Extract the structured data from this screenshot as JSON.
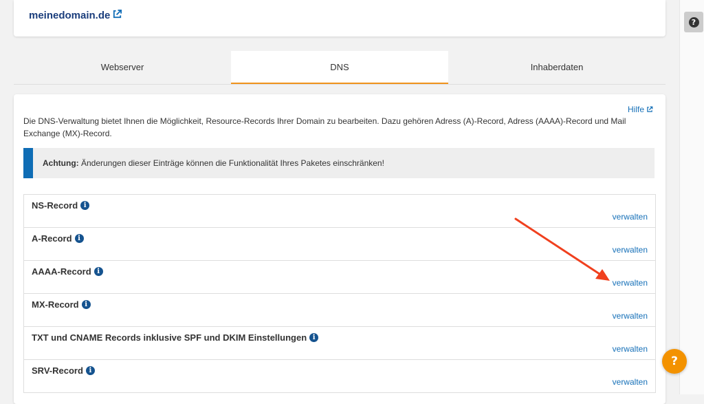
{
  "domain": {
    "name": "meinedomain.de",
    "external_icon": "external-link-icon"
  },
  "help_button": {
    "symbol": "?",
    "icon": "question-icon"
  },
  "tabs": [
    {
      "label": "Webserver",
      "active": false
    },
    {
      "label": "DNS",
      "active": true
    },
    {
      "label": "Inhaberdaten",
      "active": false
    }
  ],
  "content": {
    "help_link": "Hilfe",
    "intro": "Die DNS-Verwaltung bietet Ihnen die Möglichkeit, Resource-Records Ihrer Domain zu bearbeiten. Dazu gehören Adress (A)-Record, Adress (AAAA)-Record und Mail Exchange (MX)-Record.",
    "alert_label": "Achtung:",
    "alert_text": " Änderungen dieser Einträge können die Funktionalität Ihres Paketes einschränken!"
  },
  "records": [
    {
      "title": "NS-Record",
      "action": "verwalten"
    },
    {
      "title": "A-Record",
      "action": "verwalten"
    },
    {
      "title": "AAAA-Record",
      "action": "verwalten"
    },
    {
      "title": "MX-Record",
      "action": "verwalten"
    },
    {
      "title": "TXT und CNAME Records inklusive SPF und DKIM Einstellungen",
      "action": "verwalten"
    },
    {
      "title": "SRV-Record",
      "action": "verwalten"
    }
  ],
  "fab": {
    "symbol": "?"
  },
  "colors": {
    "accent": "#f39200",
    "link": "#1670b8",
    "info": "#15538f",
    "alert_bar": "#0f6db5",
    "arrow": "#f0401e"
  }
}
